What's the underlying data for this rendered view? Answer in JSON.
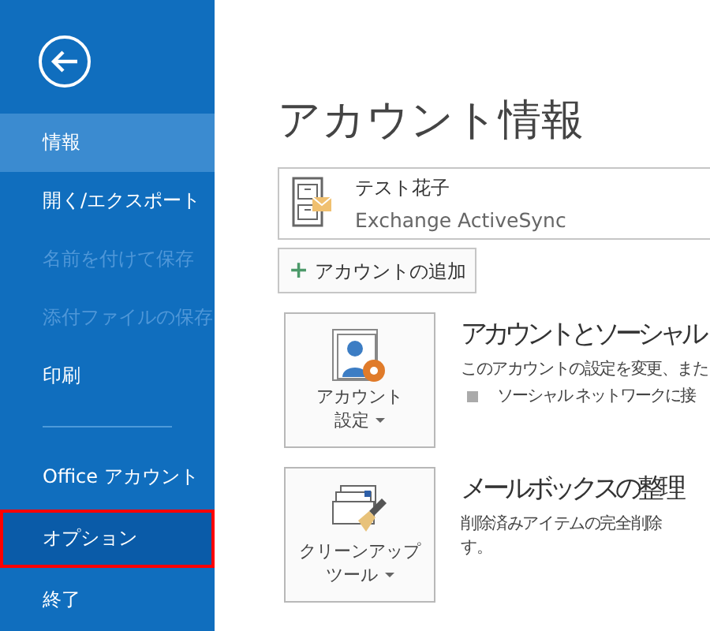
{
  "sidebar": {
    "items": [
      {
        "kind": "item",
        "label": "情報",
        "selected": true,
        "disabled": false,
        "highlighted": false
      },
      {
        "kind": "item",
        "label": "開く/エクスポート",
        "selected": false,
        "disabled": false,
        "highlighted": false
      },
      {
        "kind": "item",
        "label": "名前を付けて保存",
        "selected": false,
        "disabled": true,
        "highlighted": false
      },
      {
        "kind": "item",
        "label": "添付ファイルの保存",
        "selected": false,
        "disabled": true,
        "highlighted": false
      },
      {
        "kind": "item",
        "label": "印刷",
        "selected": false,
        "disabled": false,
        "highlighted": false
      },
      {
        "kind": "separator"
      },
      {
        "kind": "item",
        "label": "Office アカウント",
        "selected": false,
        "disabled": false,
        "highlighted": false
      },
      {
        "kind": "item",
        "label": "オプション",
        "selected": false,
        "disabled": false,
        "highlighted": true
      },
      {
        "kind": "item",
        "label": "終了",
        "selected": false,
        "disabled": false,
        "highlighted": false
      }
    ]
  },
  "main": {
    "title": "アカウント情報",
    "account": {
      "name": "テスト花子",
      "type": "Exchange ActiveSync"
    },
    "add_account_button": {
      "icon": "+",
      "label": "アカウントの追加"
    },
    "sections": [
      {
        "kind": "settings",
        "button_lines": [
          "アカウント",
          "設定"
        ],
        "heading": "アカウントとソーシャル",
        "description": "このアカウントの設定を変更、また",
        "bullets": [
          "ソーシャル ネットワークに接"
        ]
      },
      {
        "kind": "cleanup",
        "button_lines": [
          "クリーンアップ",
          "ツール"
        ],
        "heading": "メールボックスの整理",
        "description": "削除済みアイテムの完全削除",
        "continuation": "す。"
      }
    ]
  }
}
